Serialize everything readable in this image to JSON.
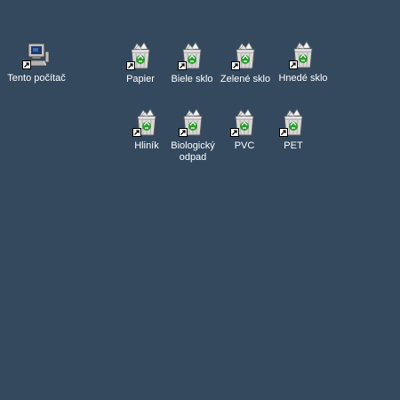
{
  "desktop": {
    "background_color": "#34495e",
    "icons": [
      {
        "label": "Tento počítač",
        "icon": "computer-icon"
      },
      {
        "label": "Papier",
        "icon": "recycle-bin-icon"
      },
      {
        "label": "Biele sklo",
        "icon": "recycle-bin-icon"
      },
      {
        "label": "Zelené sklo",
        "icon": "recycle-bin-icon"
      },
      {
        "label": "Hnedé sklo",
        "icon": "recycle-bin-icon"
      },
      {
        "label": "Hliník",
        "icon": "recycle-bin-icon"
      },
      {
        "label": "Biologický\nodpad",
        "icon": "recycle-bin-icon"
      },
      {
        "label": "PVC",
        "icon": "recycle-bin-icon"
      },
      {
        "label": "PET",
        "icon": "recycle-bin-icon"
      }
    ]
  }
}
